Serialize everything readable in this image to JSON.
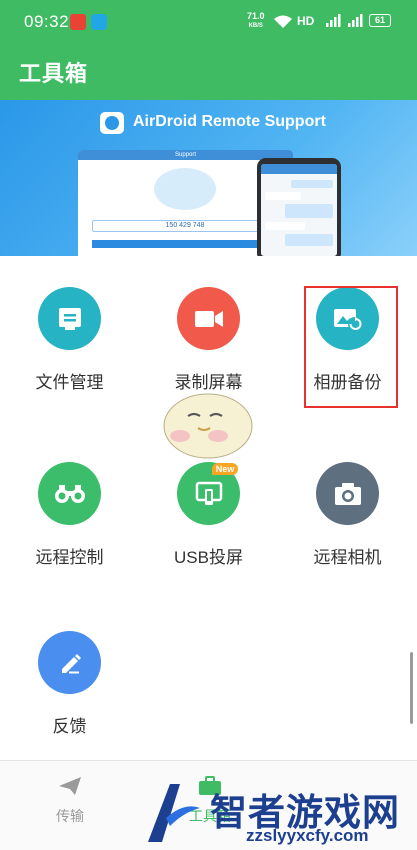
{
  "status_bar": {
    "time": "09:32",
    "network_speed_value": "71.0",
    "network_speed_unit": "KB/S",
    "hd_label": "HD",
    "signal1_label": "4G",
    "signal2_label": "4G",
    "battery_level": "61"
  },
  "app_bar": {
    "title": "工具箱"
  },
  "banner": {
    "title": "AirDroid Remote Support",
    "laptop_header": "Support",
    "laptop_code": "150 429 748"
  },
  "tools": [
    {
      "label": "文件管理",
      "icon": "file-manager-icon",
      "color": "#26b3c4"
    },
    {
      "label": "录制屏幕",
      "icon": "record-screen-icon",
      "color": "#f1594a"
    },
    {
      "label": "相册备份",
      "icon": "album-backup-icon",
      "color": "#26b3c4"
    },
    {
      "label": "远程控制",
      "icon": "remote-control-icon",
      "color": "#3cbd6b"
    },
    {
      "label": "USB投屏",
      "icon": "usb-cast-icon",
      "color": "#3cbd6b",
      "badge": "New"
    },
    {
      "label": "远程相机",
      "icon": "remote-camera-icon",
      "color": "#5e6f80"
    },
    {
      "label": "反馈",
      "icon": "feedback-icon",
      "color": "#4a8ef0"
    }
  ],
  "bottom_nav": {
    "transfer_label": "传输",
    "tools_label": "工具箱"
  },
  "watermark": {
    "name": "智者游戏网",
    "site": "zzslyyxcfy.com"
  },
  "colors": {
    "primary": "#3fbc63",
    "highlight_box": "#e8312f"
  }
}
